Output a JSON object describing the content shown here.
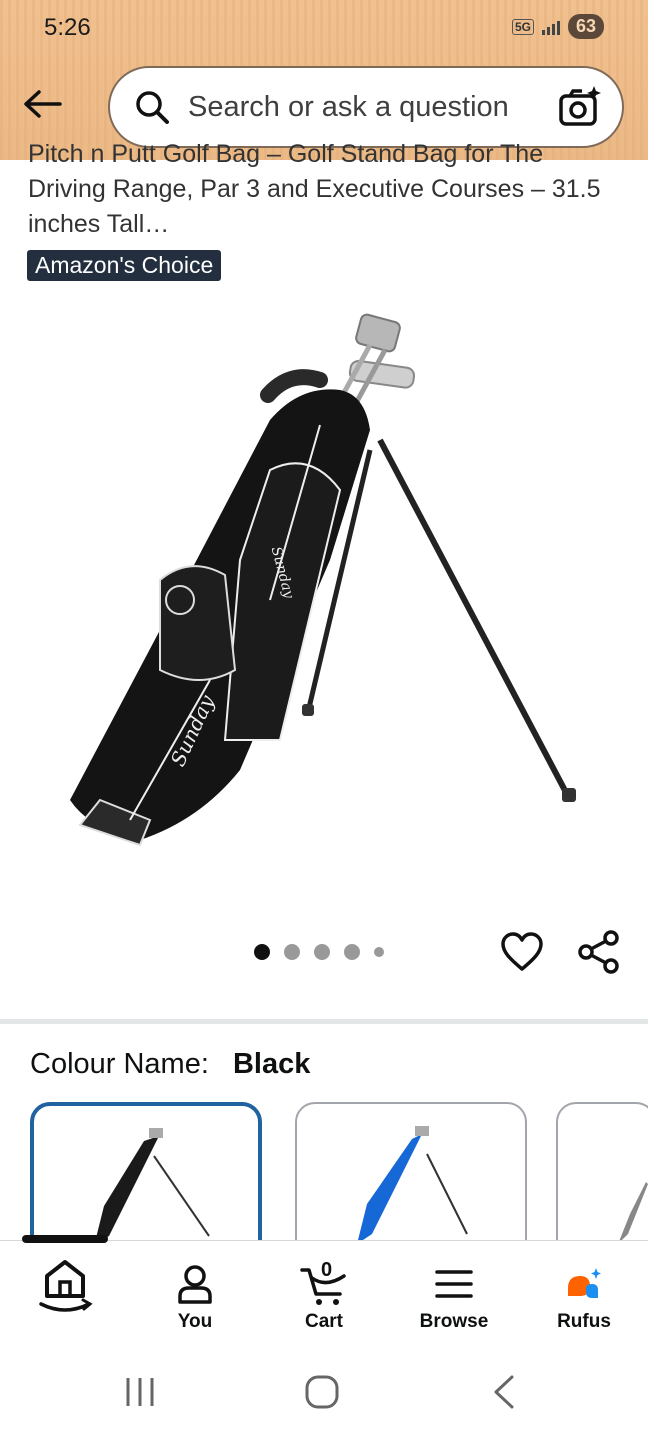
{
  "status_bar": {
    "time": "5:26",
    "network": "5G",
    "battery": "63"
  },
  "search": {
    "placeholder": "Search or ask a question"
  },
  "product": {
    "title_cut": "Pitch n Putt Golf Bag – Golf Stand Bag for The",
    "title": "Driving Range, Par 3 and Executive Courses – 31.5 inches Tall…",
    "badge": "Amazon's Choice",
    "image_dots": {
      "count": 5,
      "active_index": 0
    }
  },
  "colour": {
    "label": "Colour Name:",
    "value": "Black",
    "swatches": [
      "Black",
      "Blue",
      "Grey"
    ]
  },
  "bottom_nav": [
    {
      "label": "",
      "icon": "home-icon"
    },
    {
      "label": "You",
      "icon": "user-icon"
    },
    {
      "label": "Cart",
      "icon": "cart-icon",
      "count": "0"
    },
    {
      "label": "Browse",
      "icon": "menu-icon"
    },
    {
      "label": "Rufus",
      "icon": "rufus-icon"
    }
  ],
  "colors": {
    "header": "#eebc8a",
    "badge_bg": "#232f3e",
    "selected_border": "#2162a1",
    "rufus_orange": "#ff6200",
    "rufus_blue": "#1b8ef2"
  }
}
